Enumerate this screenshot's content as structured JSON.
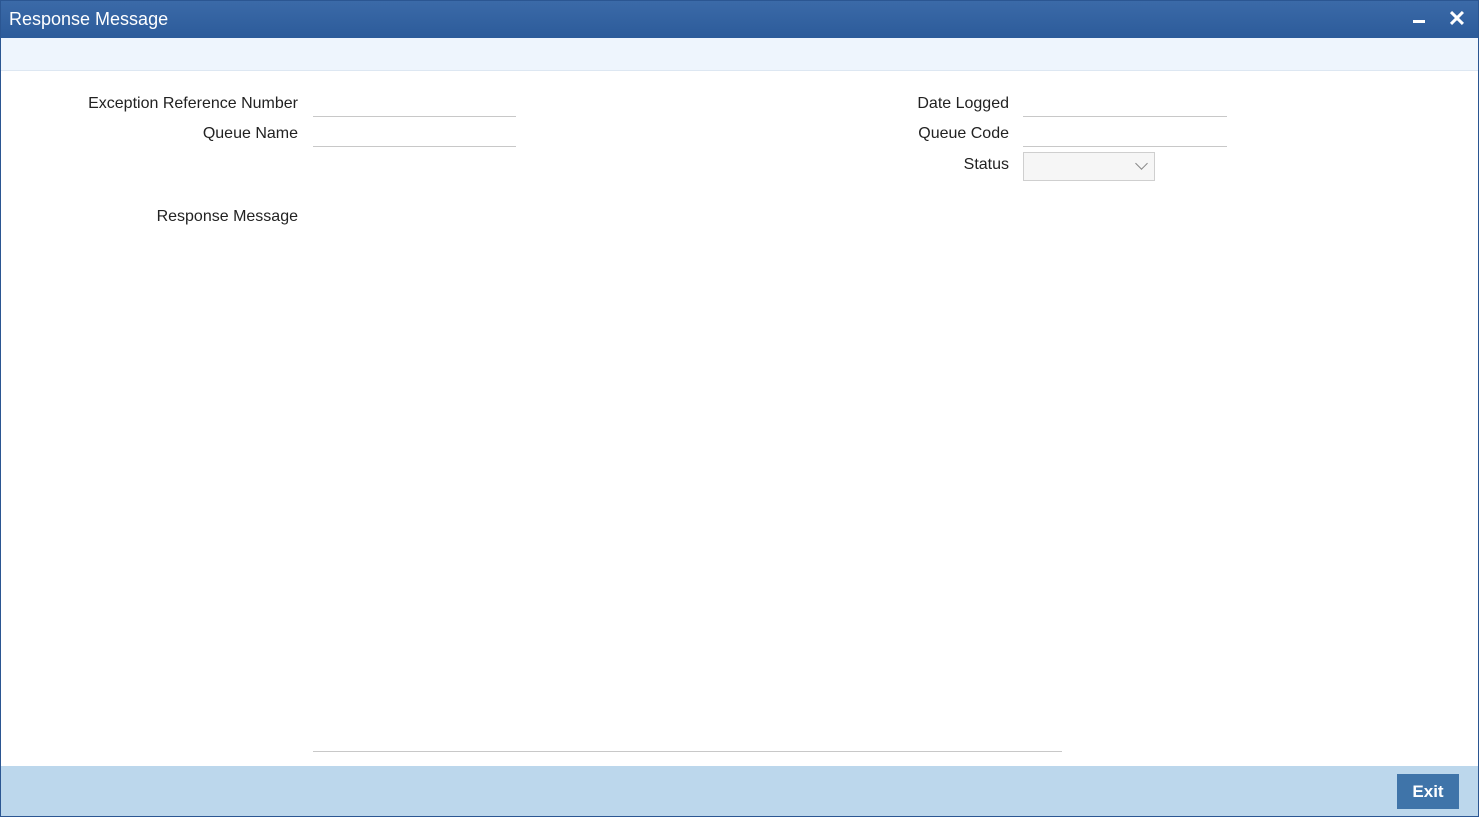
{
  "window": {
    "title": "Response Message"
  },
  "form": {
    "exception_ref_label": "Exception Reference Number",
    "exception_ref_value": "",
    "queue_name_label": "Queue Name",
    "queue_name_value": "",
    "date_logged_label": "Date Logged",
    "date_logged_value": "",
    "queue_code_label": "Queue Code",
    "queue_code_value": "",
    "status_label": "Status",
    "status_value": "",
    "response_message_label": "Response Message",
    "response_message_value": ""
  },
  "footer": {
    "exit_label": "Exit"
  },
  "icons": {
    "minimize": "minimize-icon",
    "close": "close-icon",
    "dropdown": "chevron-down-icon"
  },
  "colors": {
    "titlebar": "#2c5b9a",
    "footer": "#bcd7ec",
    "exit_button": "#3f74a9"
  }
}
